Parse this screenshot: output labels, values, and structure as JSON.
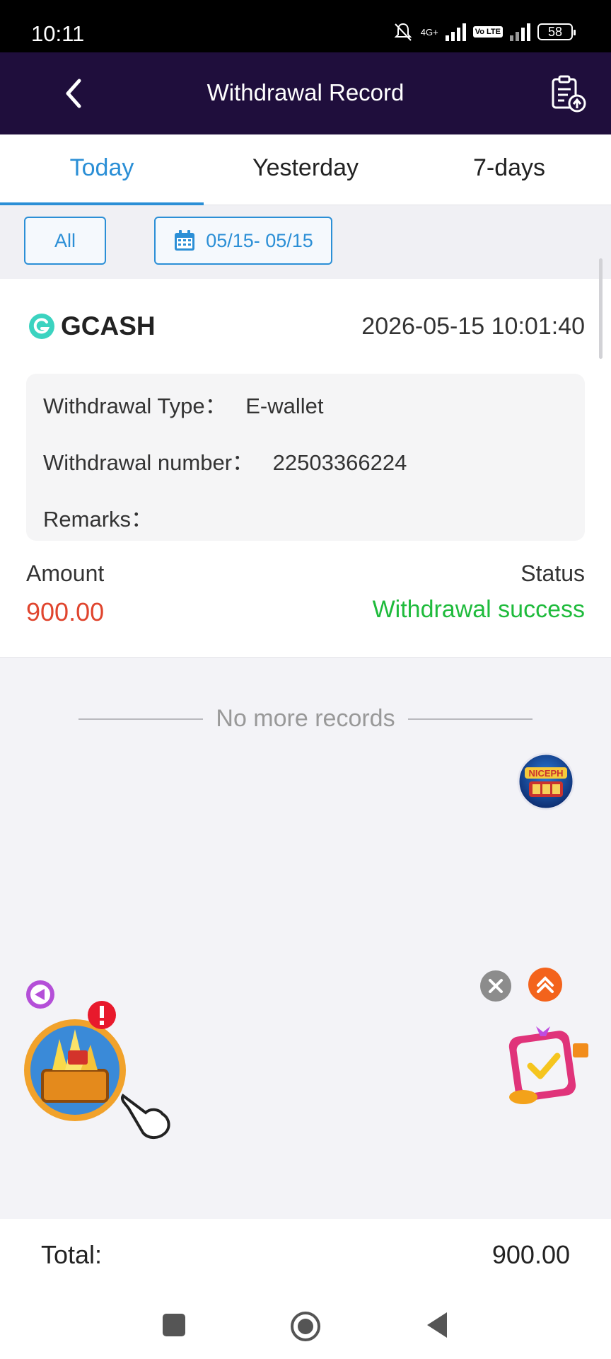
{
  "status_bar": {
    "time": "10:11",
    "network": "4G+",
    "volte": "Vo LTE",
    "battery": "58"
  },
  "header": {
    "title": "Withdrawal Record"
  },
  "tabs": [
    {
      "label": "Today",
      "active": true
    },
    {
      "label": "Yesterday",
      "active": false
    },
    {
      "label": "7-days",
      "active": false
    }
  ],
  "filters": {
    "all_label": "All",
    "date_range": "05/15- 05/15"
  },
  "record": {
    "method": "GCASH",
    "datetime": "2026-05-15 10:01:40",
    "type_label": "Withdrawal Type：",
    "type_value": "E-wallet",
    "number_label": "Withdrawal number：",
    "number_value": "22503366224",
    "remarks_label": "Remarks：",
    "remarks_value": "",
    "amount_label": "Amount",
    "amount_value": "900.00",
    "status_label": "Status",
    "status_value": "Withdrawal success"
  },
  "list_end": "No more records",
  "floating": {
    "badge_logo": "NICEPH"
  },
  "totals": {
    "label": "Total:",
    "value": "900.00"
  },
  "colors": {
    "header_bg": "#1f0e3c",
    "accent": "#2b8fd6",
    "amount": "#e0452e",
    "success": "#1fbb3c"
  },
  "icons": [
    "back-arrow-icon",
    "record-upload-icon",
    "calendar-icon",
    "gcash-icon",
    "close-icon",
    "chevron-up-icon"
  ]
}
